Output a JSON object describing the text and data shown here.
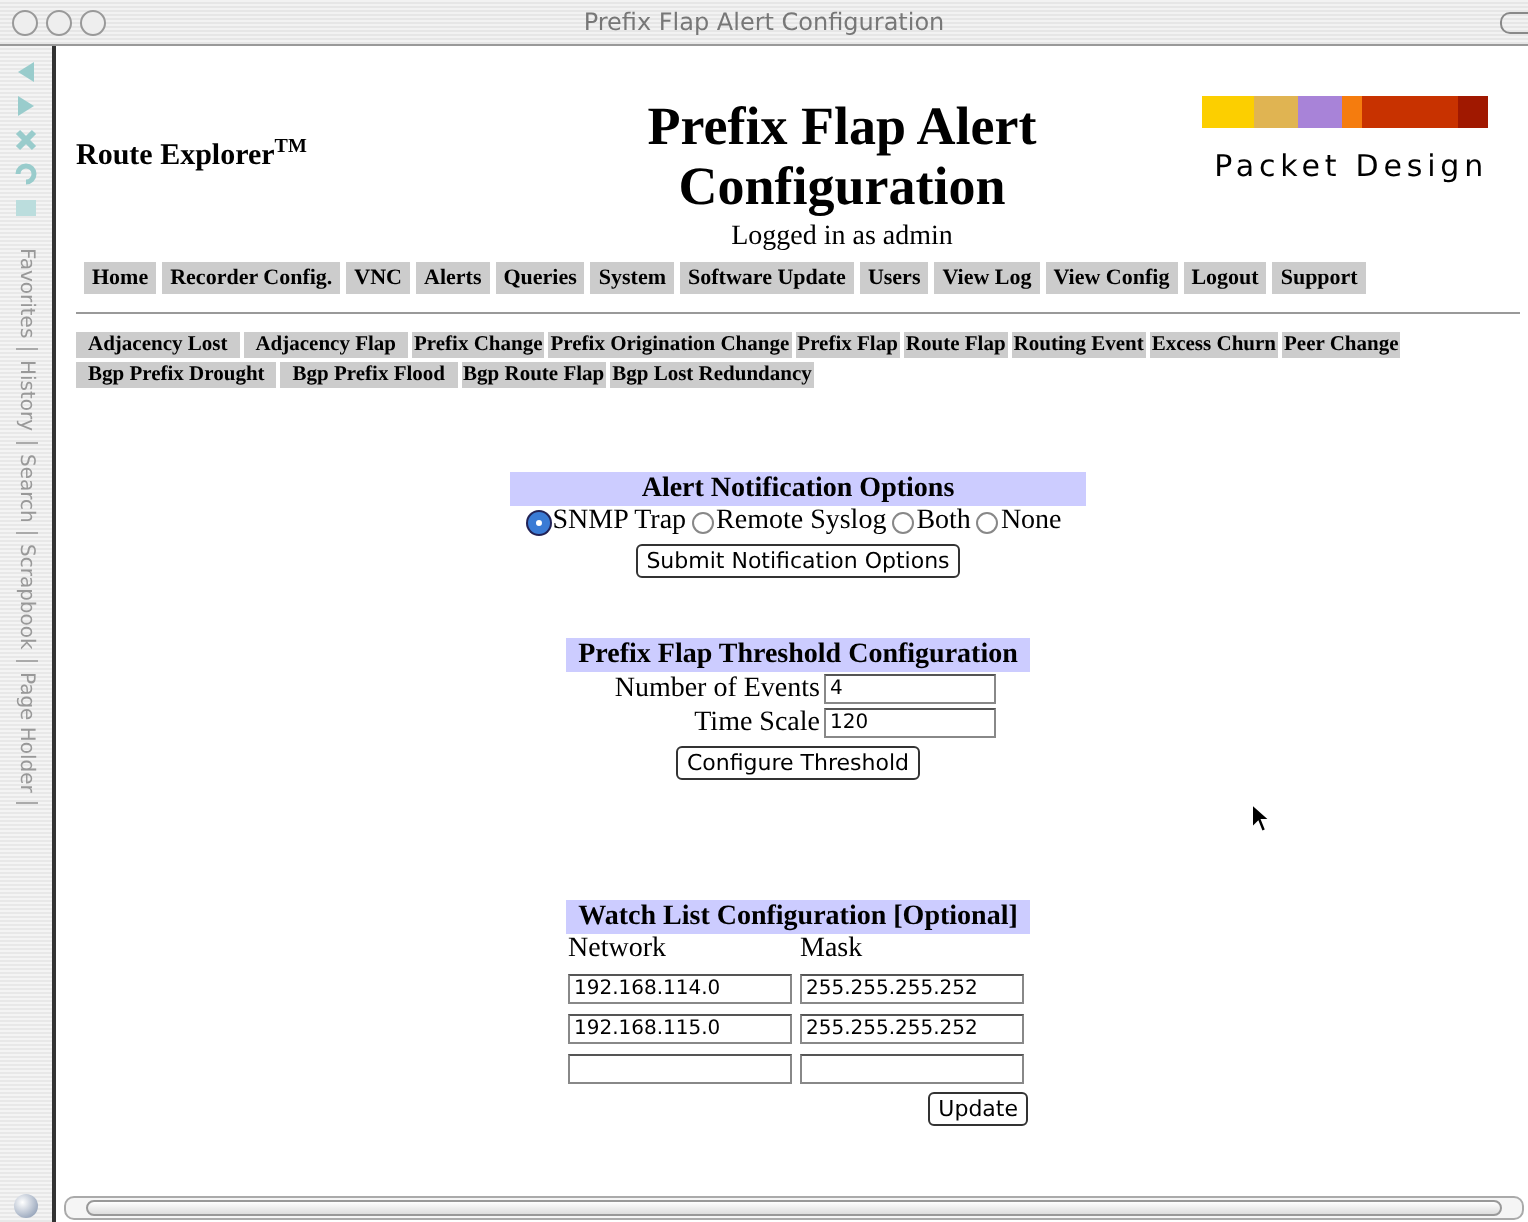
{
  "window": {
    "title": "Prefix Flap Alert Configuration"
  },
  "sidebar": {
    "tabs": [
      {
        "label": "Favorites"
      },
      {
        "label": "History"
      },
      {
        "label": "Search"
      },
      {
        "label": "Scrapbook"
      },
      {
        "label": "Page Holder"
      }
    ]
  },
  "header": {
    "product": "Route Explorer$^{TM}$",
    "title": "Prefix Flap Alert Configuration",
    "login": "Logged in as admin",
    "logo_text": "Packet Design"
  },
  "nav": [
    "Home",
    "Recorder Config.",
    "VNC",
    "Alerts",
    "Queries",
    "System",
    "Software Update",
    "Users",
    "View Log",
    "View Config",
    "Logout",
    "Support"
  ],
  "alert_tabs": [
    [
      "Adjacency Lost",
      "Adjacency Flap",
      "Prefix Change",
      "Prefix Origination Change",
      "Prefix Flap",
      "Route Flap",
      "Routing Event",
      "Excess Churn",
      "Peer Change"
    ],
    [
      "Bgp Prefix Drought",
      "Bgp Prefix Flood",
      "Bgp Route Flap",
      "Bgp Lost Redundancy"
    ]
  ],
  "notification": {
    "heading": "Alert Notification Options",
    "options": [
      {
        "label": "SNMP Trap",
        "selected": true
      },
      {
        "label": "Remote Syslog",
        "selected": false
      },
      {
        "label": "Both",
        "selected": false
      },
      {
        "label": "None",
        "selected": false
      }
    ],
    "button": "Submit Notification Options"
  },
  "threshold": {
    "heading": "Prefix Flap Threshold Configuration",
    "fields": [
      {
        "label": "Number of Events",
        "value": "4"
      },
      {
        "label": "Time Scale",
        "value": "120"
      }
    ],
    "button": "Configure Threshold"
  },
  "watch_list": {
    "heading": "Watch List Configuration [Optional]",
    "columns": [
      "Network",
      "Mask"
    ],
    "rows": [
      {
        "kind": "entry",
        "network": "192.168.114.0",
        "mask": "255.255.255.252"
      },
      {
        "kind": "entry",
        "network": "192.168.115.0",
        "mask": "255.255.255.252"
      },
      {
        "kind": "blank"
      }
    ],
    "button": "Update"
  }
}
